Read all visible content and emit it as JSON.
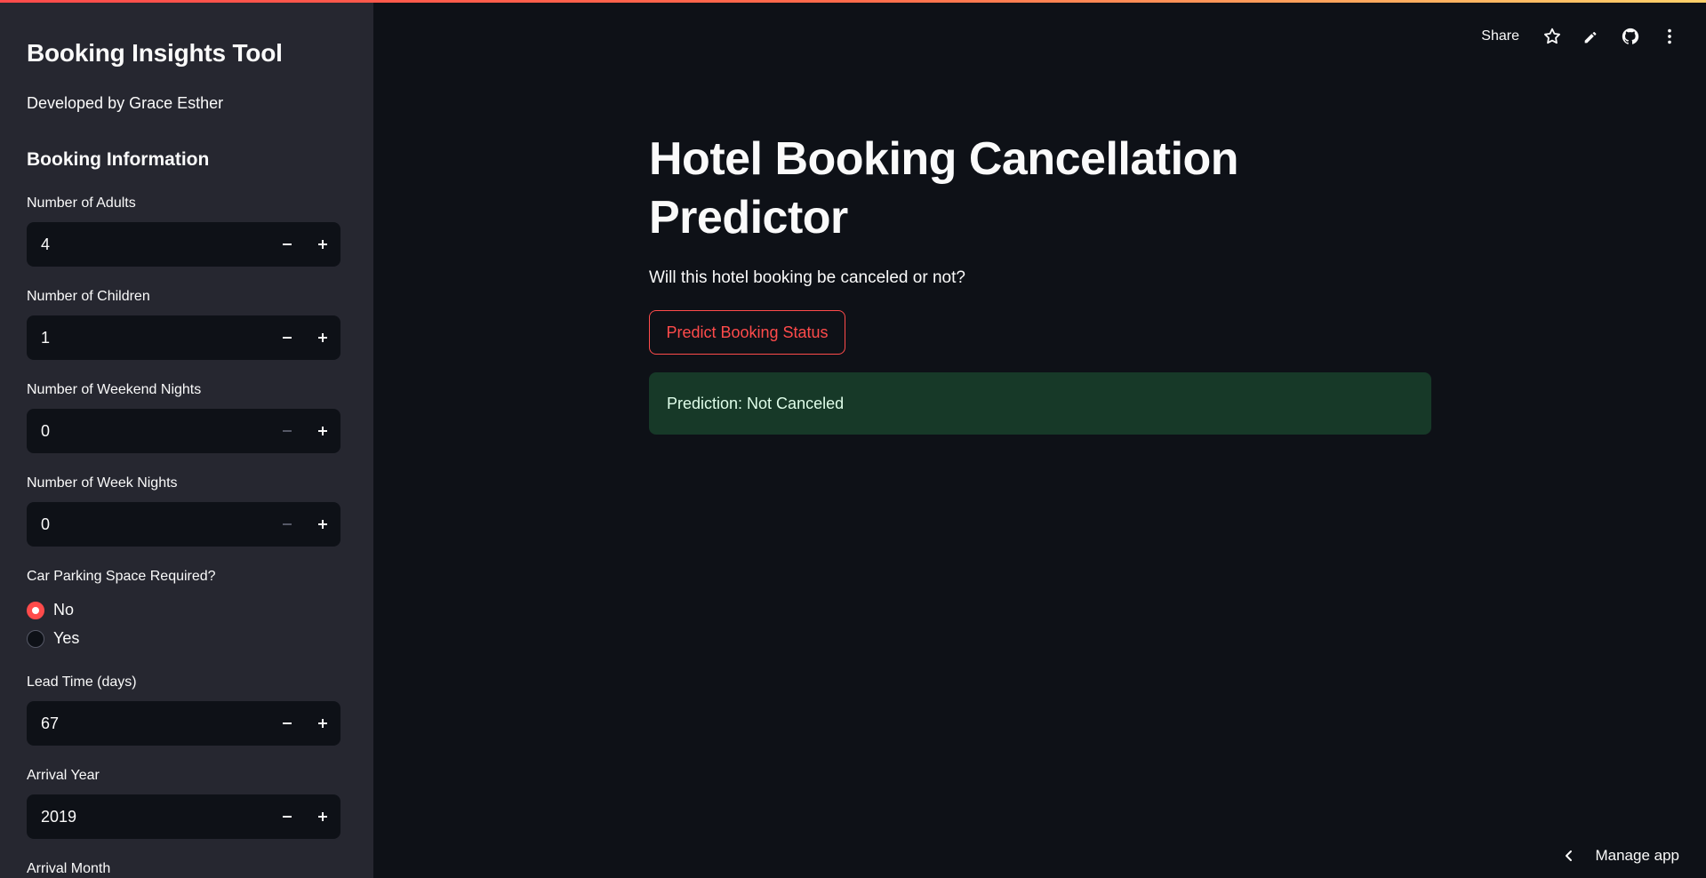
{
  "sidebar": {
    "title": "Booking Insights Tool",
    "subtitle": "Developed by Grace Esther",
    "section_title": "Booking Information",
    "fields": [
      {
        "label": "Number of Adults",
        "value": "4",
        "minus_disabled": false
      },
      {
        "label": "Number of Children",
        "value": "1",
        "minus_disabled": false
      },
      {
        "label": "Number of Weekend Nights",
        "value": "0",
        "minus_disabled": true
      },
      {
        "label": "Number of Week Nights",
        "value": "0",
        "minus_disabled": true
      }
    ],
    "parking": {
      "label": "Car Parking Space Required?",
      "options": [
        "No",
        "Yes"
      ],
      "selected": "No"
    },
    "lead_time": {
      "label": "Lead Time (days)",
      "value": "67"
    },
    "arrival_year": {
      "label": "Arrival Year",
      "value": "2019"
    },
    "arrival_month": {
      "label": "Arrival Month"
    }
  },
  "header": {
    "share_label": "Share",
    "icons": [
      "star-icon",
      "edit-icon",
      "github-icon",
      "more-vertical-icon"
    ]
  },
  "main": {
    "title": "Hotel Booking Cancellation Predictor",
    "subtitle": "Will this hotel booking be canceled or not?",
    "predict_button": "Predict Booking Status",
    "result": "Prediction: Not Canceled"
  },
  "footer": {
    "manage_label": "Manage app"
  },
  "colors": {
    "accent": "#ff4b4b",
    "background": "#0e1117",
    "sidebar": "#262730",
    "success_bg": "#173928"
  }
}
